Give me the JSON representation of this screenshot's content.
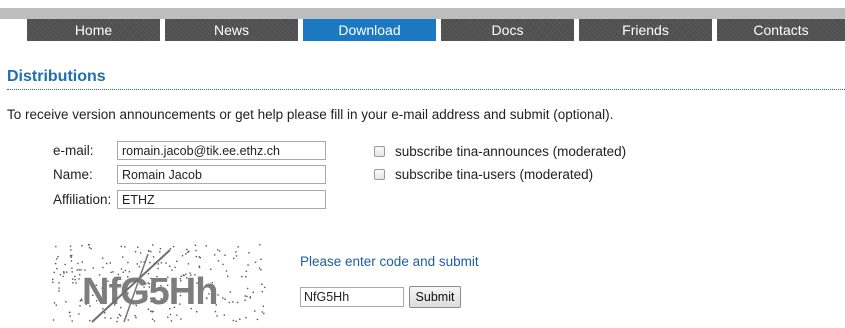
{
  "nav": {
    "tabs": [
      {
        "label": "Home",
        "active": false
      },
      {
        "label": "News",
        "active": false
      },
      {
        "label": "Download",
        "active": true
      },
      {
        "label": "Docs",
        "active": false
      },
      {
        "label": "Friends",
        "active": false
      },
      {
        "label": "Contacts",
        "active": false
      }
    ]
  },
  "colors": {
    "accent": "#1a79c2",
    "heading": "#1f6fb0",
    "nav_bg": "#4f4f4f"
  },
  "page": {
    "heading": "Distributions",
    "intro": "To receive version announcements or get help please fill in your e-mail address and submit (optional)."
  },
  "form": {
    "email_label": "e-mail:",
    "email_value": "romain.jacob@tik.ee.ethz.ch",
    "name_label": "Name:",
    "name_value": "Romain Jacob",
    "affiliation_label": "Affiliation:",
    "affiliation_value": "ETHZ",
    "subscribe_announces": "subscribe tina-announces (moderated)",
    "subscribe_users": "subscribe tina-users (moderated)"
  },
  "captcha": {
    "image_text": "NfG5Hh",
    "prompt": "Please enter code and submit",
    "code_value": "NfG5Hh",
    "submit_label": "Submit"
  }
}
